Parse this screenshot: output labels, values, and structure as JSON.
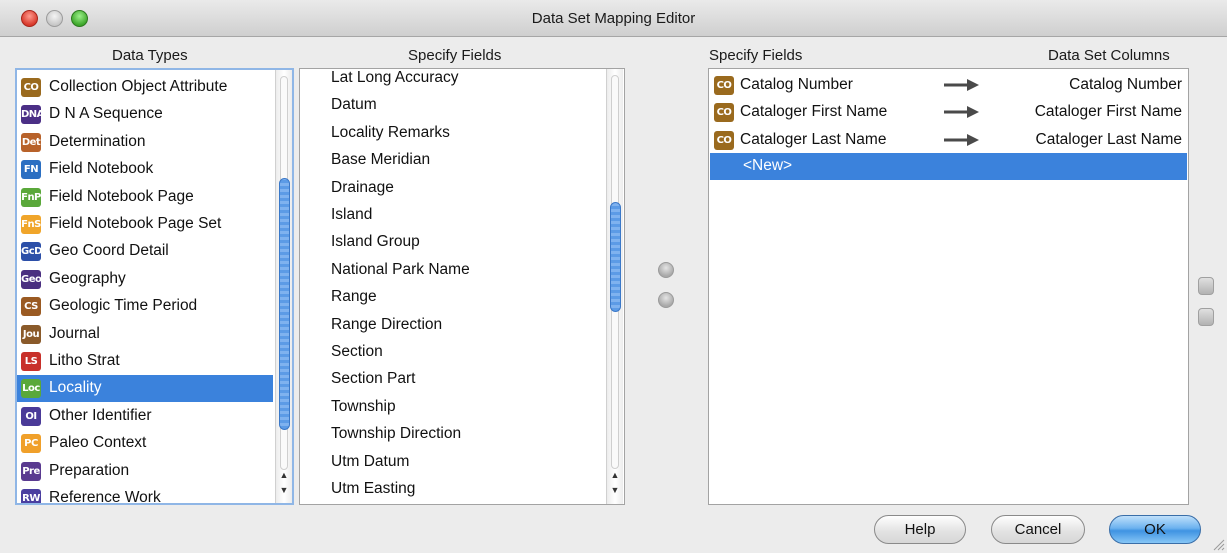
{
  "window": {
    "title": "Data Set Mapping Editor"
  },
  "headers": {
    "data_types": "Data Types",
    "specify_fields_left": "Specify Fields",
    "specify_fields_right": "Specify Fields",
    "data_set_columns": "Data Set Columns"
  },
  "data_types": [
    {
      "badge": "CO",
      "label": "Collection Object Attribute",
      "color": "#9a6a1e",
      "icon": "collection-object-attribute-icon"
    },
    {
      "badge": "DNA",
      "label": "D N A Sequence",
      "color": "#4b2f86",
      "icon": "dna-sequence-icon"
    },
    {
      "badge": "Det",
      "label": "Determination",
      "color": "#b8622a",
      "icon": "determination-icon"
    },
    {
      "badge": "FN",
      "label": "Field Notebook",
      "color": "#2b6fc2",
      "icon": "field-notebook-icon"
    },
    {
      "badge": "FnP",
      "label": "Field Notebook Page",
      "color": "#5aa83a",
      "icon": "field-notebook-page-icon"
    },
    {
      "badge": "FnS",
      "label": "Field Notebook Page Set",
      "color": "#f0a52a",
      "icon": "field-notebook-page-set-icon"
    },
    {
      "badge": "GcD",
      "label": "Geo Coord Detail",
      "color": "#2c4fa8",
      "icon": "geo-coord-detail-icon"
    },
    {
      "badge": "Geo",
      "label": "Geography",
      "color": "#4a2f80",
      "icon": "geography-icon"
    },
    {
      "badge": "CS",
      "label": "Geologic Time Period",
      "color": "#9a5a22",
      "icon": "geologic-time-period-icon"
    },
    {
      "badge": "Jou",
      "label": "Journal",
      "color": "#8a5a2a",
      "icon": "journal-icon"
    },
    {
      "badge": "LS",
      "label": "Litho Strat",
      "color": "#c8302a",
      "icon": "litho-strat-icon"
    },
    {
      "badge": "Loc",
      "label": "Locality",
      "color": "#5aa83a",
      "icon": "locality-icon"
    },
    {
      "badge": "OI",
      "label": "Other Identifier",
      "color": "#4a3a98",
      "icon": "other-identifier-icon"
    },
    {
      "badge": "PC",
      "label": "Paleo Context",
      "color": "#f0a02a",
      "icon": "paleo-context-icon"
    },
    {
      "badge": "Pre",
      "label": "Preparation",
      "color": "#5a3a90",
      "icon": "preparation-icon"
    },
    {
      "badge": "RW",
      "label": "Reference Work",
      "color": "#4a3ea0",
      "icon": "reference-work-icon"
    }
  ],
  "selected_data_type": "Locality",
  "specify_fields_left": [
    "Lat Long Accuracy",
    "Datum",
    "Locality Remarks",
    "Base Meridian",
    "Drainage",
    "Island",
    "Island Group",
    "National Park Name",
    "Range",
    "Range Direction",
    "Section",
    "Section Part",
    "Township",
    "Township Direction",
    "Utm Datum",
    "Utm Easting"
  ],
  "mappings": [
    {
      "badge": "CO",
      "field": "Catalog Number",
      "column": "Catalog Number",
      "color": "#9a6a1e"
    },
    {
      "badge": "CO",
      "field": "Cataloger First Name",
      "column": "Cataloger First Name",
      "color": "#9a6a1e"
    },
    {
      "badge": "CO",
      "field": "Cataloger Last Name",
      "column": "Cataloger Last Name",
      "color": "#9a6a1e"
    }
  ],
  "new_row_label": "<New>",
  "buttons": {
    "help": "Help",
    "cancel": "Cancel",
    "ok": "OK"
  },
  "colors": {
    "selection": "#3b82dc",
    "focus_border": "#8fb6e6"
  }
}
